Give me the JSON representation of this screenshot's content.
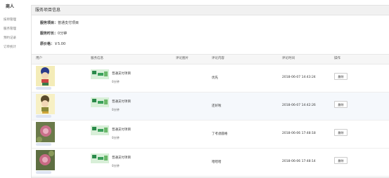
{
  "sidebar": {
    "title": "商人",
    "items": [
      "技师管理",
      "服务管理",
      "预约记录",
      "订单统计"
    ]
  },
  "panel": {
    "title": "服务项目信息"
  },
  "info": {
    "name_label": "服务项目：",
    "name_value": "普通支付项目",
    "duration_label": "服务时长：",
    "duration_value": "0分钟",
    "price_label": "原价格：",
    "price_value": "￥5.00"
  },
  "table": {
    "headers": [
      "用户",
      "服务信息",
      "评论图片",
      "评论内容",
      "评论时间",
      "操作"
    ],
    "rows": [
      {
        "service_name": "普通支付项目",
        "duration": "0分钟",
        "content": "优先",
        "time": "2018-06-07 14:43:24",
        "action": "删除"
      },
      {
        "service_name": "普通支付项目",
        "duration": "0分钟",
        "content": "还好啦",
        "time": "2018-06-07 14:42:26",
        "action": "删除"
      },
      {
        "service_name": "普通支付项目",
        "duration": "0分钟",
        "content": "了考虑圆格",
        "time": "2018-06-06 17:48:18",
        "action": "删除"
      },
      {
        "service_name": "普通支付项目",
        "duration": "0分钟",
        "content": "哈哈哈",
        "time": "2018-06-06 17:48:14",
        "action": "删除"
      }
    ]
  }
}
